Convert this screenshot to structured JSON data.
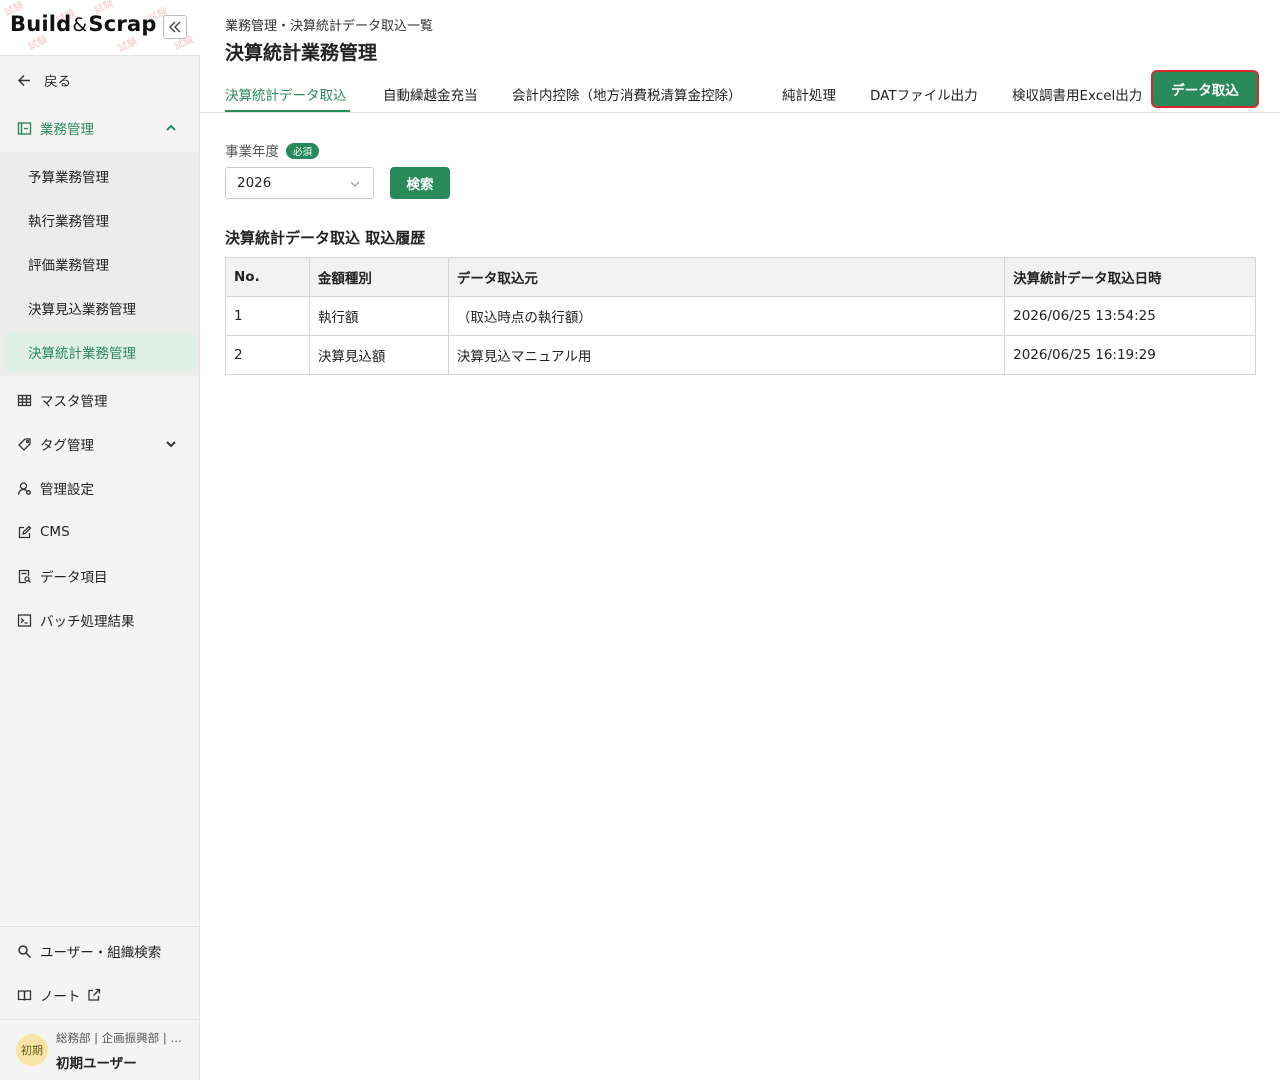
{
  "app": {
    "logo_part1": "Build",
    "logo_amp": "&",
    "logo_part2": "Scrap",
    "stamp_text": "試験"
  },
  "sidebar": {
    "back_label": "戻る",
    "section_label": "業務管理",
    "sub_items": [
      {
        "label": "予算業務管理",
        "active": false
      },
      {
        "label": "執行業務管理",
        "active": false
      },
      {
        "label": "評価業務管理",
        "active": false
      },
      {
        "label": "決算見込業務管理",
        "active": false
      },
      {
        "label": "決算統計業務管理",
        "active": true
      }
    ],
    "items": [
      {
        "label": "マスタ管理",
        "icon": "table-icon"
      },
      {
        "label": "タグ管理",
        "icon": "tag-icon"
      },
      {
        "label": "管理設定",
        "icon": "user-settings-icon"
      },
      {
        "label": "CMS",
        "icon": "edit-icon"
      },
      {
        "label": "データ項目",
        "icon": "document-search-icon"
      },
      {
        "label": "バッチ処理結果",
        "icon": "terminal-icon"
      }
    ],
    "bottom_items": [
      {
        "label": "ユーザー・組織検索",
        "icon": "search-icon"
      },
      {
        "label": "ノート",
        "icon": "book-icon"
      }
    ],
    "user": {
      "avatar_text": "初期",
      "org": "総務部 | 企画振興部 | …",
      "name": "初期ユーザー"
    }
  },
  "header": {
    "breadcrumb": "業務管理・決算統計データ取込一覧",
    "title": "決算統計業務管理"
  },
  "tabs": [
    {
      "label": "決算統計データ取込",
      "active": true
    },
    {
      "label": "自動繰越金充当",
      "active": false
    },
    {
      "label": "会計内控除（地方消費税清算金控除）",
      "active": false
    },
    {
      "label": "純計処理",
      "active": false
    },
    {
      "label": "DATファイル出力",
      "active": false
    },
    {
      "label": "検収調書用Excel出力",
      "active": false
    }
  ],
  "import_button_label": "データ取込",
  "search_form": {
    "year_label": "事業年度",
    "required_badge": "必須",
    "year_value": "2026",
    "search_button": "検索"
  },
  "history": {
    "title": "決算統計データ取込 取込履歴",
    "columns": [
      "No.",
      "金額種別",
      "データ取込元",
      "決算統計データ取込日時"
    ],
    "rows": [
      [
        "1",
        "執行額",
        "（取込時点の執行額）",
        "2026/06/25 13:54:25"
      ],
      [
        "2",
        "決算見込額",
        "決算見込マニュアル用",
        "2026/06/25 16:19:29"
      ]
    ]
  },
  "colors": {
    "accent": "#2a8a5c",
    "highlight": "#d32c2c",
    "sidebar_bg": "#f4f4f4"
  }
}
